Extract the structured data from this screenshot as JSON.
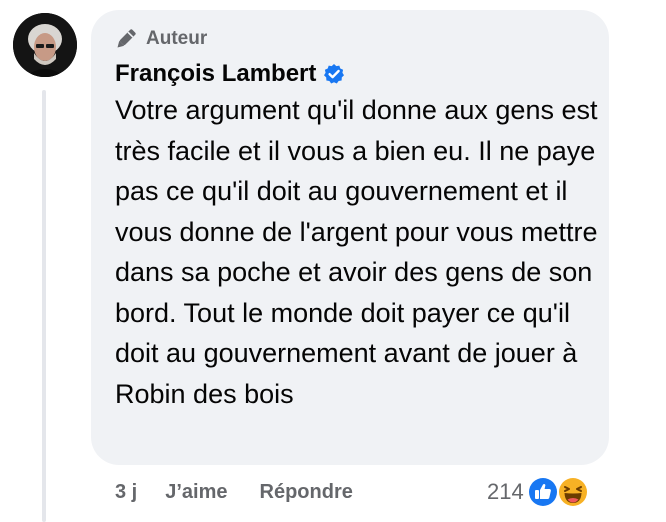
{
  "comment": {
    "badge": {
      "icon": "pen-icon",
      "label": "Auteur"
    },
    "author": {
      "name": "François Lambert",
      "verified_icon": "verified-badge-icon",
      "verified_color": "#1877f2",
      "avatar": "profile-photo-avatar"
    },
    "text": "Votre argument qu'il donne aux gens est très facile et il vous a bien eu. Il ne paye pas ce qu'il doit au gouvernement et il vous donne de l'argent pour vous mettre dans sa poche et avoir des gens de son bord. Tout le monde doit payer ce qu'il doit au gouvernement avant de jouer à Robin des bois",
    "actions": {
      "timestamp": "3 j",
      "like_label": "J’aime",
      "reply_label": "Répondre"
    },
    "reactions": {
      "count": "214",
      "icons": [
        "like-reaction-icon",
        "haha-reaction-icon"
      ]
    }
  },
  "colors": {
    "bubble_background": "#f0f2f5",
    "secondary_text": "#65676b",
    "primary_text": "#050505",
    "like_blue": "#1877f2",
    "haha_yellow": "#f7b125"
  }
}
